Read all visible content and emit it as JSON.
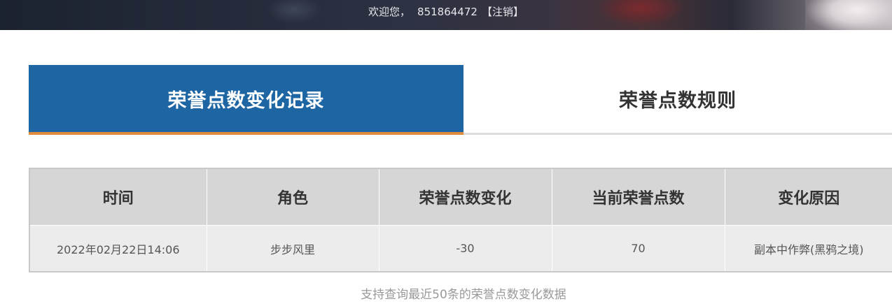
{
  "header": {
    "welcome": "欢迎您，",
    "user_id": "851864472",
    "logout": "【注销】"
  },
  "tabs": [
    {
      "label": "荣誉点数变化记录",
      "active": true
    },
    {
      "label": "荣誉点数规则",
      "active": false
    }
  ],
  "table": {
    "columns": [
      "时间",
      "角色",
      "荣誉点数变化",
      "当前荣誉点数",
      "变化原因"
    ],
    "rows": [
      [
        "2022年02月22日14:06",
        "步步风里",
        "-30",
        "70",
        "副本中作弊(黑鸦之境)"
      ]
    ]
  },
  "footer_note": "支持查询最近50条的荣誉点数变化数据",
  "colors": {
    "tab_active_bg": "#1d66a3",
    "tab_active_underline": "#e08a3b",
    "header_cell_bg": "#d6d6d6",
    "body_cell_bg": "#ececec"
  }
}
